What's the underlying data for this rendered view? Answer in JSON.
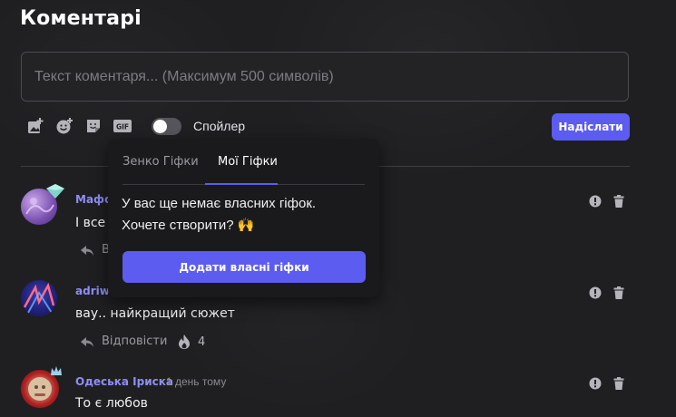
{
  "header": {
    "title": "Коментарі"
  },
  "composer": {
    "placeholder": "Текст коментаря... (Максимум 500 символів)",
    "tools": [
      "add-image-icon",
      "emoji-icon",
      "sticker-icon",
      "gif-icon"
    ],
    "gif_label": "GIF",
    "spoiler_label": "Спойлер",
    "spoiler_on": false,
    "send_label": "Надіслати"
  },
  "gif_popup": {
    "tabs": [
      {
        "label": "Зенко Гіфки",
        "active": false
      },
      {
        "label": "Мої Гіфки",
        "active": true
      }
    ],
    "message_line1": "У вас ще немає власних гіфок.",
    "message_line2": "Хочете створити? 🙌",
    "add_button_label": "Додати власні гіфки"
  },
  "comments": [
    {
      "author": "Маффін",
      "time": "",
      "text": "І все т",
      "reply_label": "Ві",
      "reactions": null
    },
    {
      "author": "adriwq",
      "time": "",
      "text": "вау.. найкращий сюжет",
      "reply_label": "Відповісти",
      "reactions": "4"
    },
    {
      "author": "Одеська Іриска",
      "time": "1 день тому",
      "text": "То є любов",
      "reply_label": "",
      "reactions": null
    }
  ],
  "colors": {
    "accent": "#5c5cf0",
    "author": "#8e8ef5",
    "background": "#1f1f22"
  }
}
